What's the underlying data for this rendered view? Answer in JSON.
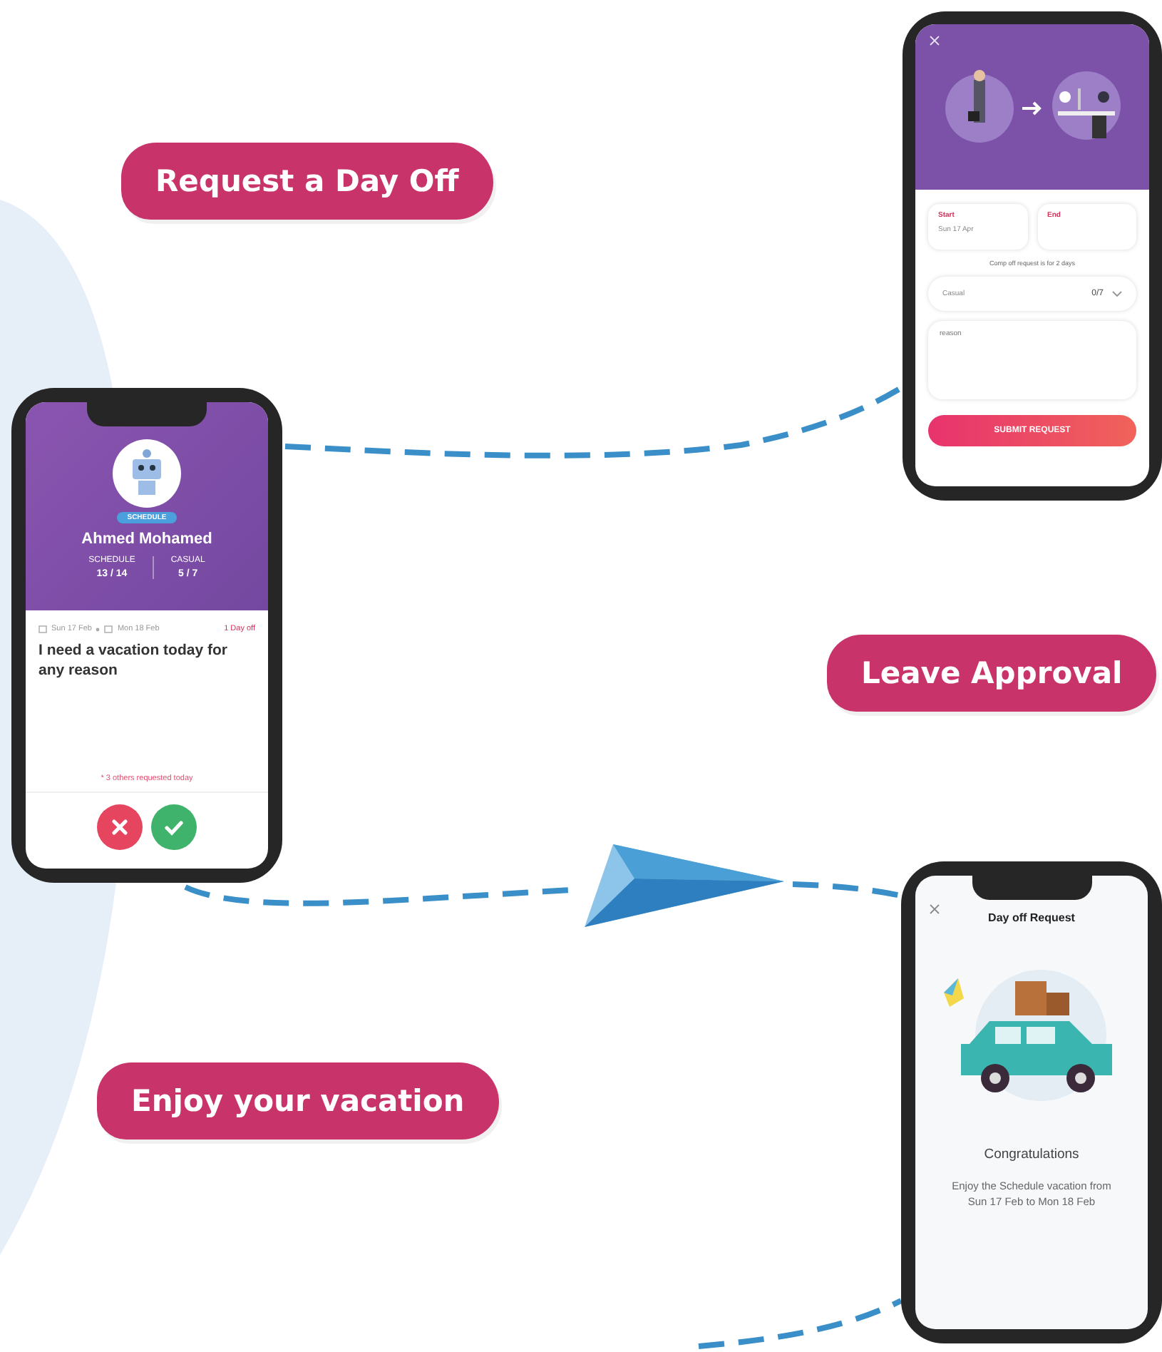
{
  "banners": [
    {
      "text": "Request a Day Off"
    },
    {
      "text": "Leave Approval"
    },
    {
      "text": "Enjoy your vacation"
    }
  ],
  "request_screen": {
    "start": {
      "label": "Start",
      "value": "Sun 17 Apr"
    },
    "end": {
      "label": "End"
    },
    "note": "Comp off request is for 2 days",
    "leave_type": "Casual",
    "balance": "0/7",
    "reason_placeholder": "reason",
    "submit": "SUBMIT REQUEST"
  },
  "approval_screen": {
    "badge": "SCHEDULE",
    "name": "Ahmed Mohamed",
    "stats": [
      {
        "label": "SCHEDULE",
        "value": "13 / 14"
      },
      {
        "label": "CASUAL",
        "value": "5 / 7"
      }
    ],
    "dates": [
      "Sun 17 Feb",
      "Mon 18 Feb"
    ],
    "duration": "1 Day off",
    "message": "I need a vacation today for any reason",
    "note": "* 3 others requested today"
  },
  "confirmation_screen": {
    "title": "Day off Request",
    "heading": "Congratulations",
    "message": "Enjoy the Schedule vacation from Sun 17 Feb to Mon 18 Feb"
  }
}
